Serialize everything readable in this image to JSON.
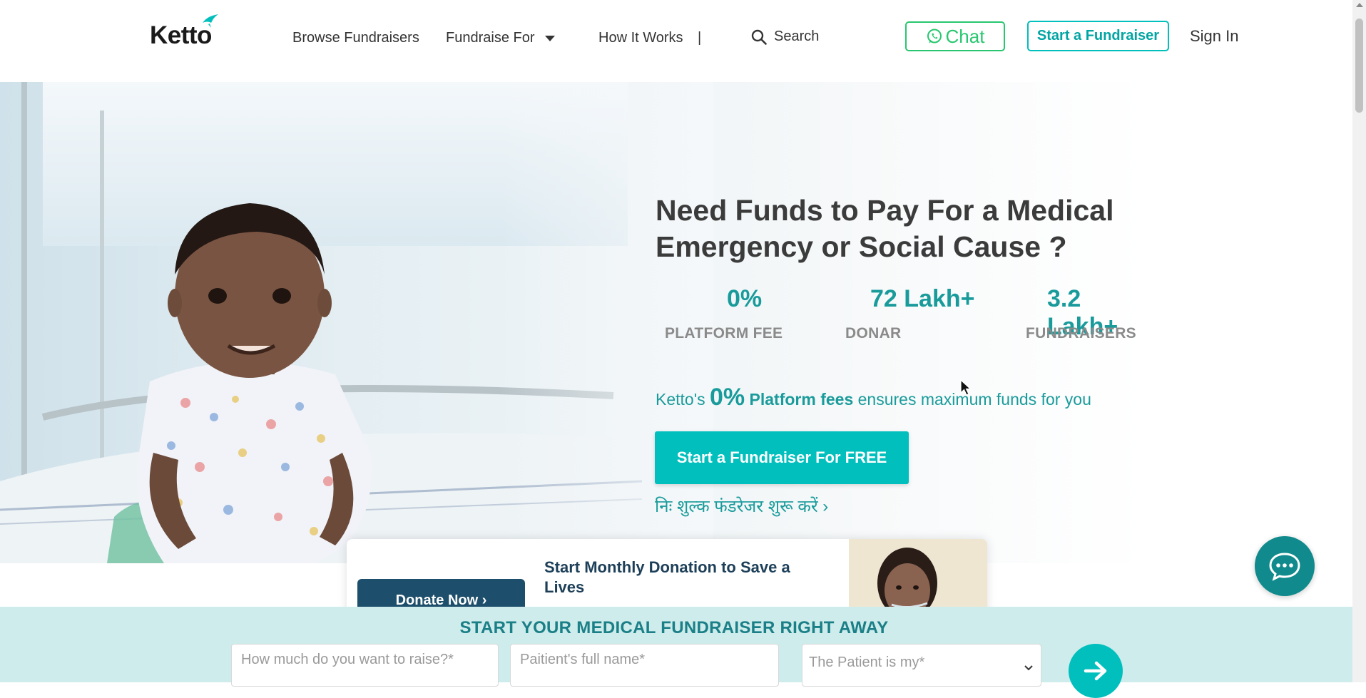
{
  "header": {
    "logo_text": "Ketto",
    "nav": {
      "browse": "Browse Fundraisers",
      "fundraise_for": "Fundraise For",
      "how_it_works": "How It Works",
      "separator": "|"
    },
    "search_label": "Search",
    "chat_label": "Chat",
    "start_fundraiser_label": "Start a Fundraiser",
    "sign_in_label": "Sign In"
  },
  "hero": {
    "headline": "Need Funds to Pay For a Medical Emergency or Social Cause ?",
    "stats": [
      {
        "value": "0%",
        "label": "PLATFORM FEE"
      },
      {
        "value": "72 Lakh+",
        "label": "DONAR"
      },
      {
        "value": "3.2 Lakh+",
        "label": "FUNDRAISERS"
      }
    ],
    "fees_prefix": "Ketto's ",
    "fees_big": "0%",
    "fees_bold": " Platform fees",
    "fees_suffix": " ensures maximum funds for you",
    "cta_label": "Start a Fundraiser For FREE",
    "hindi_link": "निः शुल्क फंडरेजर शुरू करें ›"
  },
  "monthly": {
    "donate_label": "Donate Now ›",
    "text": "Start Monthly Donation to Save a Lives"
  },
  "medical_form": {
    "title": "START YOUR MEDICAL FUNDRAISER RIGHT AWAY",
    "amount_placeholder": "How much do you want to raise?*",
    "name_placeholder": "Paitient's full name*",
    "relation_placeholder": "The Patient is my*"
  },
  "colors": {
    "brand_teal": "#01bfbd",
    "text_teal": "#1a9b9b",
    "whatsapp_green": "#28c76f",
    "navy": "#1d4e6b",
    "form_bg": "#cdeceb"
  },
  "icons": [
    "search-icon",
    "whatsapp-icon",
    "chevron-down-icon",
    "arrow-right-icon",
    "chat-bubble-icon"
  ]
}
